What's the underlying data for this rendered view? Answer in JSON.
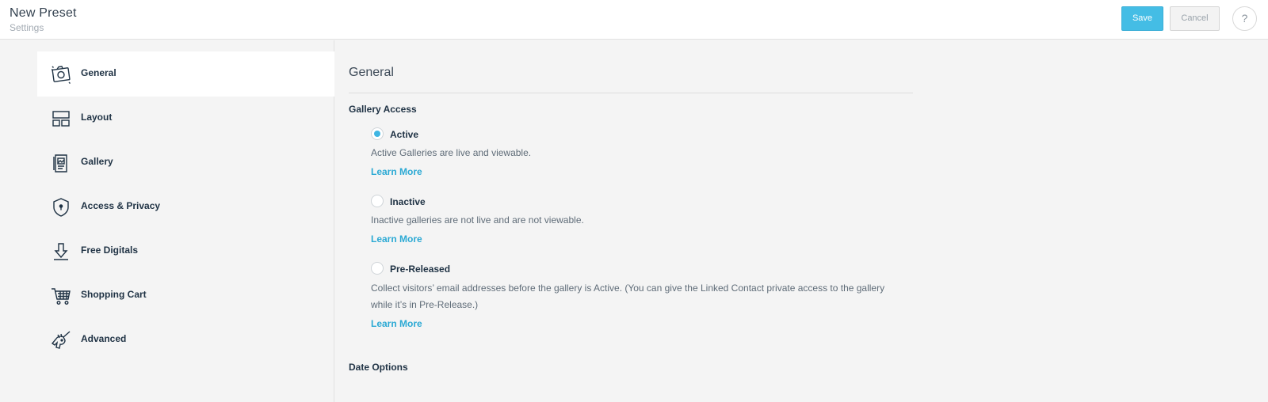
{
  "header": {
    "title": "New Preset",
    "subtitle": "Settings",
    "save_label": "Save",
    "cancel_label": "Cancel",
    "help_label": "?"
  },
  "sidebar": {
    "items": [
      {
        "label": "General",
        "icon": "camera-icon",
        "active": true
      },
      {
        "label": "Layout",
        "icon": "layout-icon",
        "active": false
      },
      {
        "label": "Gallery",
        "icon": "gallery-icon",
        "active": false
      },
      {
        "label": "Access & Privacy",
        "icon": "shield-icon",
        "active": false
      },
      {
        "label": "Free Digitals",
        "icon": "download-icon",
        "active": false
      },
      {
        "label": "Shopping Cart",
        "icon": "cart-icon",
        "active": false
      },
      {
        "label": "Advanced",
        "icon": "unicorn-icon",
        "active": false
      }
    ]
  },
  "main": {
    "section_title": "General",
    "gallery_access": {
      "title": "Gallery Access",
      "options": [
        {
          "label": "Active",
          "checked": true,
          "description": "Active Galleries are live and viewable.",
          "link": "Learn More"
        },
        {
          "label": "Inactive",
          "checked": false,
          "description": "Inactive galleries are not live and are not viewable.",
          "link": "Learn More"
        },
        {
          "label": "Pre-Released",
          "checked": false,
          "description_line1": "Collect visitors’ email addresses before the gallery is Active. (You can give the Linked Contact private access to the gallery",
          "description_line2": "while it’s in Pre-Release.)",
          "link": "Learn More"
        }
      ]
    },
    "date_options": {
      "title": "Date Options"
    }
  },
  "colors": {
    "accent": "#44bde5",
    "link": "#2ba9d4",
    "background": "#f4f4f4",
    "text_dark": "#1f3244"
  }
}
